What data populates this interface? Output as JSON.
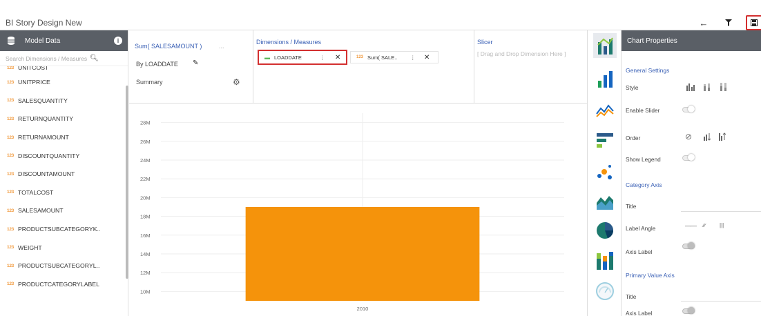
{
  "app": {
    "title": "BI Story  Design New"
  },
  "toolbar": {
    "back_icon": "arrow-left-icon",
    "filter_icon": "filter-icon",
    "save_icon": "save-icon"
  },
  "left_panel": {
    "header": "Model Data",
    "search_placeholder": "Search Dimensions / Measures",
    "type_badge": "123",
    "fields": [
      "UNITCOST",
      "UNITPRICE",
      "SALESQUANTITY",
      "RETURNQUANTITY",
      "RETURNAMOUNT",
      "DISCOUNTQUANTITY",
      "DISCOUNTAMOUNT",
      "TOTALCOST",
      "SALESAMOUNT",
      "PRODUCTSUBCATEGORYK..",
      "WEIGHT",
      "PRODUCTSUBCATEGORYL..",
      "PRODUCTCATEGORYLABEL"
    ]
  },
  "shelf": {
    "measure": "Sum( SALESAMOUNT )",
    "more": "...",
    "by": "By LOADDATE",
    "summary": "Summary",
    "dimensions_header": "Dimensions / Measures",
    "chip1": {
      "label": "LOADDATE",
      "kebab": "⋮",
      "close": "✕"
    },
    "chip2": {
      "badge": "123",
      "label": "Sum( SALE..",
      "kebab": "⋮",
      "close": "✕"
    },
    "slicer_header": "Slicer",
    "slicer_hint": "[ Drag and Drop Dimension Here ]"
  },
  "chart_data": {
    "type": "bar",
    "categories": [
      "2010"
    ],
    "values": [
      19000000
    ],
    "ylim": [
      9000000,
      29000000
    ],
    "yticks": [
      "10M",
      "12M",
      "14M",
      "16M",
      "18M",
      "20M",
      "22M",
      "24M",
      "26M",
      "28M"
    ],
    "color": "#f5930b",
    "grid": true
  },
  "right_panel": {
    "header": "Chart Properties",
    "general_settings": "General Settings",
    "style": "Style",
    "enable_slider": "Enable Slider",
    "order": "Order",
    "show_legend": "Show Legend",
    "category_axis": "Category Axis",
    "title": "Title",
    "label_angle": "Label Angle",
    "axis_label": "Axis Label",
    "primary_value_axis": "Primary Value Axis",
    "title2": "Title",
    "axis_label2": "Axis Label"
  }
}
